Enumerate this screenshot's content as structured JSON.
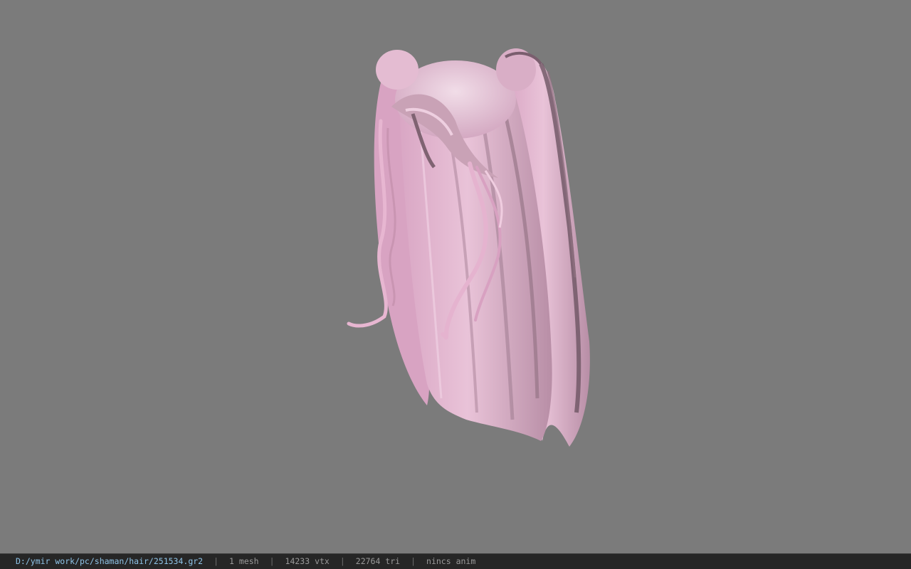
{
  "viewport": {
    "background": "#7b7b7b",
    "model": {
      "subject": "pink-ponytail-hair-mesh",
      "hair_color": "#e6b8d4"
    }
  },
  "status_bar": {
    "file_path": "D:/ymir work/pc/shaman/hair/251534.gr2",
    "separator": "|",
    "mesh_count": "1 mesh",
    "vertex_count": "14233 vtx",
    "triangle_count": "22764 tri",
    "animation": "nincs anim"
  }
}
